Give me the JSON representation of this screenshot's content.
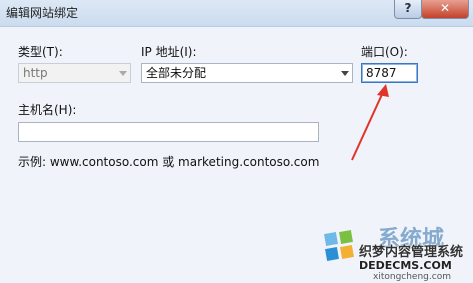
{
  "window": {
    "title": "编辑网站绑定",
    "help_label": "?",
    "close_label": "✕"
  },
  "form": {
    "type_label": "类型(T):",
    "type_value": "http",
    "ip_label": "IP 地址(I):",
    "ip_value": "全部未分配",
    "port_label": "端口(O):",
    "port_value": "8787",
    "hostname_label": "主机名(H):",
    "hostname_value": "",
    "example_text": "示例: www.contoso.com 或 marketing.contoso.com"
  },
  "annotation": {
    "arrow_color": "#e2332b"
  },
  "watermark": {
    "logo_text": "系统城",
    "cn_text": "织梦内容管理系统",
    "url_text": "DEDECMS.COM",
    "domain_text": "xitongcheng.com"
  }
}
